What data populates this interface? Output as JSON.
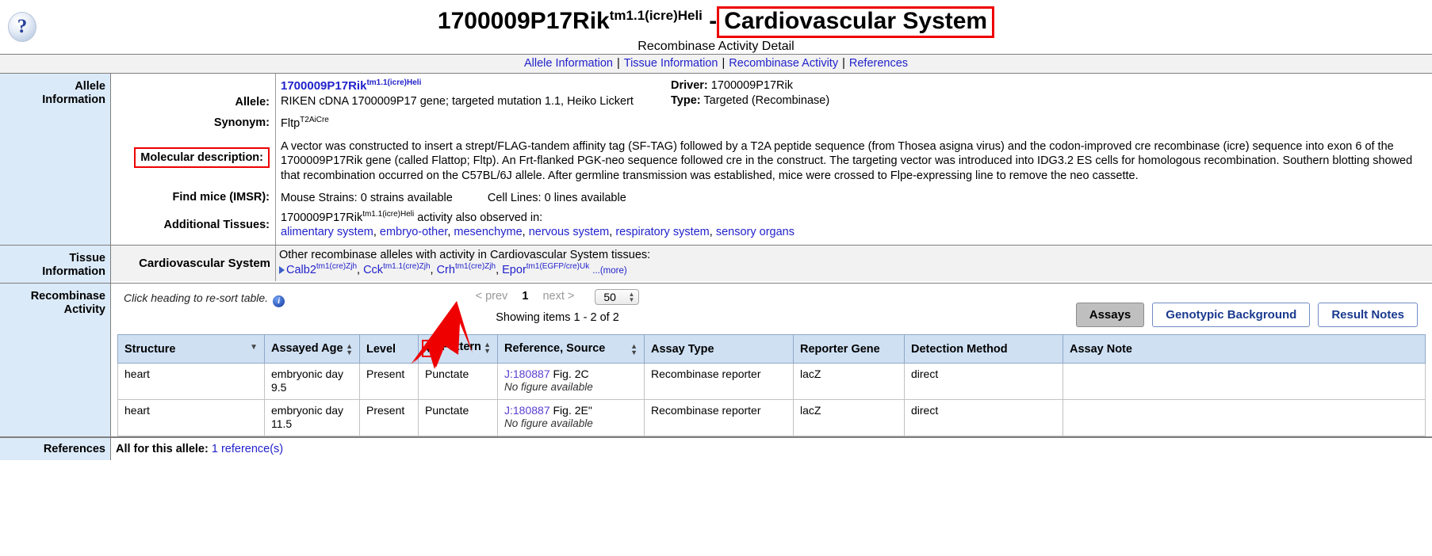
{
  "header": {
    "help_icon": "question-mark-icon",
    "allele_symbol": "1700009P17Rik",
    "allele_superscript": "tm1.1(icre)Heli",
    "separator": "-",
    "system_name": "Cardiovascular System",
    "subtitle": "Recombinase Activity Detail"
  },
  "nav": {
    "items": [
      {
        "label": "Allele Information"
      },
      {
        "label": "Tissue Information"
      },
      {
        "label": "Recombinase Activity"
      },
      {
        "label": "References"
      }
    ],
    "separator": "|"
  },
  "allele_information": {
    "section_label_line1": "Allele",
    "section_label_line2": "Information",
    "allele_key": "Allele:",
    "allele_link": "1700009P17Rik",
    "allele_link_sup": "tm1.1(icre)Heli",
    "allele_name": "RIKEN cDNA 1700009P17 gene; targeted mutation 1.1, Heiko Lickert",
    "driver_key": "Driver:",
    "driver_value": "1700009P17Rik",
    "type_key": "Type:",
    "type_value": "Targeted (Recombinase)",
    "synonym_key": "Synonym:",
    "synonym_value": "Fltp",
    "synonym_sup": "T2AiCre",
    "molecular_key": "Molecular description:",
    "molecular_value": "A vector was constructed to insert a strept/FLAG-tandem affinity tag (SF-TAG) followed by a T2A peptide sequence (from Thosea asigna virus) and the codon-improved cre recombinase (icre) sequence into exon 6 of the 1700009P17Rik gene (called Flattop; Fltp). An Frt-flanked PGK-neo sequence followed cre in the construct. The targeting vector was introduced into IDG3.2 ES cells for homologous recombination. Southern blotting showed that recombination occurred on the C57BL/6J allele. After germline transmission was established, mice were crossed to Flpe-expressing line to remove the neo cassette.",
    "imsr_key": "Find mice (IMSR):",
    "imsr_strains": "Mouse Strains: 0 strains available",
    "imsr_celllines": "Cell Lines: 0 lines available",
    "additional_key": "Additional Tissues:",
    "additional_prefix": "1700009P17Rik",
    "additional_prefix_sup": "tm1.1(icre)Heli",
    "additional_suffix": "activity also observed in:",
    "additional_tissues": [
      "alimentary system",
      "embryo-other",
      "mesenchyme",
      "nervous system",
      "respiratory system",
      "sensory organs"
    ]
  },
  "tissue_information": {
    "section_label_line1": "Tissue",
    "section_label_line2": "Information",
    "tissue_name": "Cardiovascular System",
    "other_alleles_heading": "Other recombinase alleles with activity in Cardiovascular System tissues:",
    "other_alleles": [
      {
        "symbol": "Calb2",
        "sup": "tm1(cre)Zjh"
      },
      {
        "symbol": "Cck",
        "sup": "tm1.1(cre)Zjh"
      },
      {
        "symbol": "Crh",
        "sup": "tm1(cre)Zjh"
      },
      {
        "symbol": "Epor",
        "sup": "tm1(EGFP/cre)Uk"
      }
    ],
    "more_label": "...(more)"
  },
  "recombinase_activity": {
    "section_label_line1": "Recombinase",
    "section_label_line2": "Activity",
    "resort_hint": "Click heading to re-sort table.",
    "info_icon": "info-icon",
    "prev_label": "< prev",
    "current_page": "1",
    "next_label": "next >",
    "page_size": "50",
    "showing_text": "Showing items 1 - 2 of 2",
    "tabs": [
      {
        "label": "Assays",
        "active": true
      },
      {
        "label": "Genotypic Background",
        "active": false
      },
      {
        "label": "Result Notes",
        "active": false
      }
    ],
    "columns": [
      {
        "label": "Structure",
        "sort": "desc"
      },
      {
        "label": "Assayed Age",
        "sort": "both"
      },
      {
        "label": "Level",
        "sort": "none"
      },
      {
        "label": "Pattern",
        "sort": "both"
      },
      {
        "label": "Reference, Source",
        "sort": "both"
      },
      {
        "label": "Assay Type",
        "sort": "none"
      },
      {
        "label": "Reporter Gene",
        "sort": "none"
      },
      {
        "label": "Detection Method",
        "sort": "none"
      },
      {
        "label": "Assay Note",
        "sort": "none"
      }
    ],
    "level_sort_highlighted": true,
    "rows": [
      {
        "structure": "heart",
        "assayed_age": "embryonic day 9.5",
        "level": "Present",
        "pattern": "Punctate",
        "reference_id": "J:180887",
        "reference_fig": "Fig. 2C",
        "reference_note": "No figure available",
        "assay_type": "Recombinase reporter",
        "reporter_gene": "lacZ",
        "detection_method": "direct",
        "assay_note": ""
      },
      {
        "structure": "heart",
        "assayed_age": "embryonic day 11.5",
        "level": "Present",
        "pattern": "Punctate",
        "reference_id": "J:180887",
        "reference_fig": "Fig. 2E\"",
        "reference_note": "No figure available",
        "assay_type": "Recombinase reporter",
        "reporter_gene": "lacZ",
        "detection_method": "direct",
        "assay_note": ""
      }
    ]
  },
  "references": {
    "section_label": "References",
    "all_label": "All for this allele:",
    "link_label": "1 reference(s)"
  },
  "colors": {
    "link": "#2222cc",
    "highlight_red": "#ee0000",
    "section_bg": "#dbeaf8",
    "table_header_bg": "#cfe0f3"
  }
}
